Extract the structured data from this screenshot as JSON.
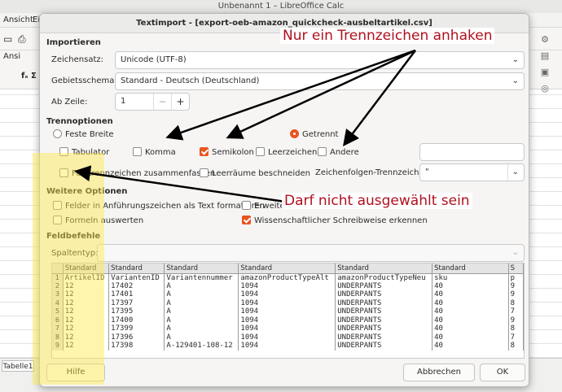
{
  "app": {
    "title": "Unbenannt 1 – LibreOffice Calc",
    "menu": [
      "Ansicht",
      "Ei"
    ],
    "sheet_tab": "Tabelle1",
    "toolbar_fragment": "Ansi",
    "formula_fragment": "fₓ Σ"
  },
  "dialog": {
    "title": "Textimport - [export-oeb-amazon_quickcheck-ausbeltartikel.csv]",
    "import": {
      "section": "Importieren",
      "charset_label": "Zeichensatz:",
      "charset_value": "Unicode (UTF-8)",
      "locale_label": "Gebietsschema:",
      "locale_value": "Standard - Deutsch (Deutschland)",
      "from_row_label": "Ab Zeile:",
      "from_row_value": "1"
    },
    "separator": {
      "section": "Trennoptionen",
      "fixed_width": "Feste Breite",
      "separated": "Getrennt",
      "tab": "Tabulator",
      "comma": "Komma",
      "semicolon": "Semikolon",
      "space": "Leerzeichen",
      "other": "Andere",
      "merge_delimiters": "Feldtrennzeichen zusammenfassen",
      "trim_spaces": "Leerräume beschneiden",
      "string_delimiter_label": "Zeichenfolgen-Trennzeichen:",
      "string_delimiter_value": "\""
    },
    "other_options": {
      "section": "Weitere Optionen",
      "quoted_as_text": "Felder in Anführungszeichen als Text formatieren",
      "extended": "Erweitert",
      "evaluate_formulas": "Formeln auswerten",
      "scientific": "Wissenschaftlicher Schreibweise erkennen"
    },
    "fields": {
      "section": "Feldbefehle",
      "column_type_label": "Spaltentyp:",
      "column_type_value": ""
    },
    "preview": {
      "header": [
        "Standard",
        "Standard",
        "Standard",
        "Standard",
        "Standard",
        "Standard",
        "S"
      ],
      "rows": [
        [
          "1",
          "ArtikelID",
          "VariantenID",
          "Variantennummer",
          "amazonProductTypeAlt",
          "amazonProductTypeNeu",
          "sku",
          "p"
        ],
        [
          "2",
          "12",
          "17402",
          "A",
          "1094",
          "UNDERPANTS",
          "40",
          "9"
        ],
        [
          "3",
          "12",
          "17401",
          "A",
          "1094",
          "UNDERPANTS",
          "40",
          "9"
        ],
        [
          "4",
          "12",
          "17397",
          "A",
          "1094",
          "UNDERPANTS",
          "40",
          "8"
        ],
        [
          "5",
          "12",
          "17395",
          "A",
          "1094",
          "UNDERPANTS",
          "40",
          "7"
        ],
        [
          "6",
          "12",
          "17400",
          "A",
          "1094",
          "UNDERPANTS",
          "40",
          "9"
        ],
        [
          "7",
          "12",
          "17399",
          "A",
          "1094",
          "UNDERPANTS",
          "40",
          "8"
        ],
        [
          "8",
          "12",
          "17396",
          "A",
          "1094",
          "UNDERPANTS",
          "40",
          "7"
        ],
        [
          "9",
          "12",
          "17398",
          "A-129401-108-12",
          "1094",
          "UNDERPANTS",
          "40",
          "8"
        ]
      ]
    },
    "buttons": {
      "help": "Hilfe",
      "cancel": "Abbrechen",
      "ok": "OK"
    }
  },
  "annotations": {
    "top": "Nur ein Trennzeichen anhaken",
    "bottom": "Darf nicht ausgewählt sein",
    "color": "#b0101e"
  }
}
